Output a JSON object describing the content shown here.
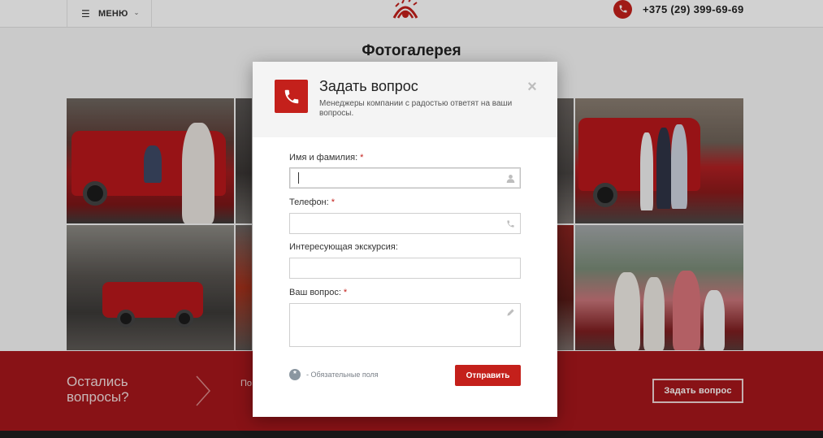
{
  "header": {
    "menu_label": "МЕНЮ",
    "phone": "+375 (29) 399-69-69"
  },
  "gallery": {
    "title": "Фотогалерея"
  },
  "banner": {
    "title": "Остались вопросы?",
    "text": "По",
    "button_label": "Задать вопрос"
  },
  "modal": {
    "title": "Задать вопрос",
    "subtitle": "Менеджеры компании с радостью ответят на ваши вопросы.",
    "fields": {
      "name_label": "Имя и фамилия:",
      "phone_label": "Телефон:",
      "tour_label": "Интересующая экскурсия:",
      "question_label": "Ваш вопрос:",
      "required_mark": "*"
    },
    "required_dot": "*",
    "required_note": "- Обязательные поля",
    "submit_label": "Отправить"
  },
  "colors": {
    "accent": "#c4201b",
    "banner": "#a6171b"
  },
  "icons": [
    "menu-icon",
    "chevron-down-icon",
    "logo-icon",
    "phone-icon",
    "close-icon",
    "user-icon",
    "pencil-icon",
    "arrow-right-icon"
  ]
}
